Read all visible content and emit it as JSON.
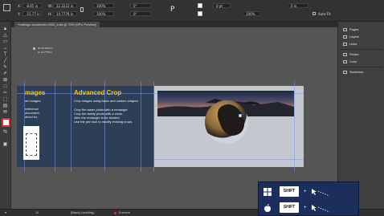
{
  "app": {
    "document_tab": "*indesign-worksheet-2020_indd @ 73% [GPU Preview]"
  },
  "control_bar": {
    "x_label": "X:",
    "x_value": "-8.65 in",
    "y_label": "Y:",
    "y_value": "-15.77 in",
    "w_label": "W:",
    "w_value": "22.2222 in",
    "h_label": "H:",
    "h_value": "14.7778 in",
    "scale_x": "100%",
    "scale_y": "100%",
    "rotate": "0°",
    "shear": "0°",
    "stroke_weight": "0 pt",
    "opacity": "100%",
    "size_value": "0 in",
    "fit_label": "Auto-Fit"
  },
  "coordinates_readout": {
    "w": "W: 22.2222 in",
    "h": "H: 14.7778 in"
  },
  "spread": {
    "left_heading": "mages",
    "left_lines": [
      "am images",
      "",
      "reference",
      "document.",
      "direct bo"
    ],
    "right_heading": "Advanced Crop",
    "right_intro": "Crop images using basic and custom shapes.",
    "right_lines": [
      "Crop the water photo with a rectangle.",
      "Crop the family photo with a circle.",
      "Alter the rectangle to be slanted.",
      "Use the pen tool to modify existing crops."
    ]
  },
  "right_panel": {
    "items": [
      {
        "label": "Pages",
        "icon": "pages-icon"
      },
      {
        "label": "Layers",
        "icon": "layers-icon"
      },
      {
        "label": "Links",
        "icon": "links-icon"
      },
      {
        "label": "Stroke",
        "icon": "stroke-icon"
      },
      {
        "label": "Color",
        "icon": "color-icon"
      },
      {
        "label": "Swatches",
        "icon": "swatches-icon"
      }
    ]
  },
  "status_bar": {
    "page_number": "11",
    "master": "[Basic] (working)",
    "errors": "8 errors"
  },
  "keyboard_overlay": {
    "windows_key": "SHIFT",
    "mac_key": "SHIFT",
    "plus": "+"
  },
  "colors": {
    "accent_heading": "#f2c418",
    "spread_bg": "#2c3f57",
    "overlay_bg": "#1c2f5c"
  }
}
